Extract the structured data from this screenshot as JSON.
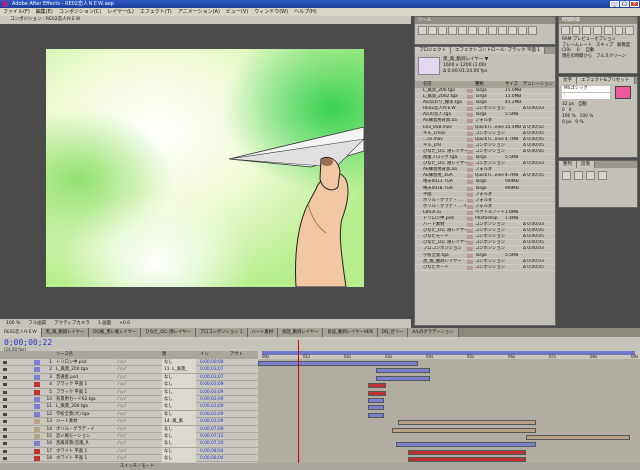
{
  "app": {
    "title": "Adobe After Effects - RE02恋人ＮＥＷ.aep"
  },
  "menu": [
    "ファイル(F)",
    "編集(E)",
    "コンポジション(C)",
    "レイヤー(L)",
    "エフェクト(T)",
    "アニメーション(A)",
    "ビュー(V)",
    "ウィンドウ(W)",
    "ヘルプ(H)"
  ],
  "window_buttons": [
    "_",
    "□",
    "×"
  ],
  "comp_viewer": {
    "tab": "コンポジション : RE02恋人ＮＥＷ",
    "zoom": "100 %",
    "quality": "フル画質",
    "view": "アクティブカメラ",
    "views": "1 画面",
    "exposure": "+0.0"
  },
  "tools_panel": {
    "title": "ツール"
  },
  "project_panel": {
    "tabs": [
      "プロジェクト",
      "エフェクトコントロール: ブラック 平面 1"
    ],
    "selected_name": "黒_風_動詞レイヤー ▼",
    "selected_info": "1600 x 1200 (1.00)",
    "selected_duration": "Δ 0;00;01;24.00 fps",
    "columns": [
      "名前",
      "種類",
      "サイズ",
      "デュレーション"
    ],
    "items": [
      {
        "name": "L_風景_200.tga",
        "type": "Targa",
        "size": "15.0MB",
        "dur": ""
      },
      {
        "name": "L_風景_2002.tga",
        "type": "Targa",
        "size": "15.0MB",
        "dur": ""
      },
      {
        "name": "A/L伝わり_緑茶.tga",
        "type": "Targa",
        "size": "45.2MB",
        "dur": ""
      },
      {
        "name": "RE02恋人ＮＥＷ",
        "type": "コンポジション",
        "size": "",
        "dur": "Δ 0;00;03"
      },
      {
        "name": "A/Lの恋人.tga",
        "type": "Targa",
        "size": "5.5MB",
        "dur": ""
      },
      {
        "name": "AE練習用背景.aa",
        "type": "フォルダ",
        "size": "",
        "dur": ""
      },
      {
        "name": "L03_058.mov",
        "type": "QuickTi...ovie",
        "size": "15.4MB",
        "dur": "Δ 0;00;02"
      },
      {
        "name": "キル_Lmov",
        "type": "コンポジション",
        "size": "",
        "dur": "Δ 0;00;05"
      },
      {
        "name": "...ce.mov",
        "type": "QuickTi...ovie",
        "size": "4.7MB",
        "dur": "Δ 0;00;05"
      },
      {
        "name": "キル_LYR",
        "type": "コンポジション",
        "size": "",
        "dur": "Δ 0;00;05"
      },
      {
        "name": "ひなた_Oに 隠レイヤー",
        "type": "コンポジション",
        "size": "",
        "dur": "Δ 0;00;05"
      },
      {
        "name": "階層ブロック.tga",
        "type": "Targa",
        "size": "5.5MB",
        "dur": ""
      },
      {
        "name": "ひなた_Oに 隠レイヤー",
        "type": "コンポジション",
        "size": "",
        "dur": "Δ 0;00;03"
      },
      {
        "name": "AE練習用背景.aa",
        "type": "フォルダ",
        "size": "",
        "dur": ""
      },
      {
        "name": "AE練習用_1GA",
        "type": "QuickTi...ovie",
        "size": "4.7MB",
        "dur": "Δ 0;00;05"
      },
      {
        "name": "晴天0011.TGA",
        "type": "Targa",
        "size": "949KB",
        "dur": ""
      },
      {
        "name": "晴天0018.TGA",
        "type": "Targa",
        "size": "949KB",
        "dur": ""
      },
      {
        "name": "平面",
        "type": "フォルダ",
        "size": "",
        "dur": ""
      },
      {
        "name": "ポリル・グラデ・ ...",
        "type": "フォルダ",
        "size": "",
        "dur": ""
      },
      {
        "name": "ポリル・グラデ・ ...イヤー",
        "type": "フォルダ",
        "size": "",
        "dur": ""
      },
      {
        "name": "LB03F.ai",
        "type": "ベクトルアート",
        "size": "1.0MB",
        "dur": ""
      },
      {
        "name": "トリロン中.psd",
        "type": "Photoshop",
        "size": "1.4MB",
        "dur": ""
      },
      {
        "name": "ハート素材",
        "type": "コンポジション",
        "size": "",
        "dur": "Δ 0;00;03"
      },
      {
        "name": "ひなた_Oに 隠レイヤー",
        "type": "コンポジション",
        "size": "",
        "dur": "Δ 0;00;05"
      },
      {
        "name": "ひなたモード",
        "type": "コンポジション",
        "size": "",
        "dur": "Δ 0;00;05"
      },
      {
        "name": "ひなた_Oに 隠レイヤー",
        "type": "コンポジション",
        "size": "",
        "dur": "Δ 0;00;05"
      },
      {
        "name": "ブロコンポジション",
        "type": "コンポジション",
        "size": "",
        "dur": "Δ 0;00;03"
      },
      {
        "name": "学校全景.tga",
        "type": "Targa",
        "size": "5.5MB",
        "dur": ""
      },
      {
        "name": "黒_風_動詞レイヤー",
        "type": "コンポジション",
        "size": "",
        "dur": "Δ 0;00;03"
      },
      {
        "name": "ひなたネード",
        "type": "コンポジション",
        "size": "",
        "dur": "Δ 0;00;05"
      }
    ]
  },
  "preview_panel": {
    "title": "時間制御",
    "ram_label": "RAM プレビューオプション",
    "framerate_label": "フレームレート",
    "skip_label": "スキップ",
    "resolution_label": "解像度",
    "framerate": "(29)",
    "skip": "0",
    "resolution": "自動",
    "from_label": "現在の時間から",
    "fullscreen_label": "フルスクリーン"
  },
  "text_panel": {
    "tabs": [
      "文字",
      "エフェクト&プリセット"
    ],
    "font": "MSゴシック",
    "font_style": "-",
    "size": "32 px",
    "tracking": "自動",
    "leading": "0",
    "scale_v": "100 %",
    "scale_h": "100 %",
    "baseline": "0 px",
    "tsume": "0 %",
    "swatch_color": "#ef5a9c"
  },
  "align_panel": {
    "tabs": [
      "整列",
      "段落"
    ]
  },
  "timeline": {
    "tabs": [
      "RE02恋人ＮＥＷ",
      "黒_風_動詞レイヤー",
      "DQ風_黒い風レイヤー",
      "ひなた_Oに 隠レイヤー",
      "ブロコンポジション 1",
      "ハート素材",
      "会話_動詞レイヤー",
      "長居_動詞レイヤーVEN",
      "DQ_ゼリー",
      "A/Lのグラデーション"
    ],
    "timecode": "0;00;00;22",
    "fps": "(24.00 fps)",
    "col_source": "ソース名",
    "col_parent": "親",
    "col_in": "イン",
    "col_out": "アウト",
    "ruler_labels": [
      "00s",
      "01s",
      "02s",
      "03s",
      "04s",
      "05s",
      "06s",
      "07s",
      "08s",
      "09s"
    ],
    "footer": "スイッチ / モード",
    "layers": [
      {
        "num": "1",
        "name": "トリロン中.psd",
        "parent": "なし",
        "in": "0;00;00;00",
        "color": "#7a7fd1"
      },
      {
        "num": "2",
        "name": "L_風景_200.tga",
        "parent": "11. L_風景_",
        "in": "0;00;03;07",
        "color": "#7a7fd1"
      },
      {
        "num": "3",
        "name": "普通屋.psd",
        "parent": "なし",
        "in": "0;00;03;07",
        "color": "#7a7fd1"
      },
      {
        "num": "4",
        "name": "ブラック 平面 1",
        "parent": "なし",
        "in": "0;00;03;09",
        "color": "#c03232"
      },
      {
        "num": "5",
        "name": "ブラック 平面 1",
        "parent": "なし",
        "in": "0;00;03;09",
        "color": "#c03232"
      },
      {
        "num": "10",
        "name": "背景用カード02.tga",
        "parent": "なし",
        "in": "0;00;03;09",
        "color": "#7a7fd1"
      },
      {
        "num": "11",
        "name": "L_風景_200.tga",
        "parent": "なし",
        "in": "0;00;03;09",
        "color": "#7a7fd1"
      },
      {
        "num": "12",
        "name": "学校全景(大).tga",
        "parent": "なし",
        "in": "0;00;03;09",
        "color": "#7a7fd1"
      },
      {
        "num": "13",
        "name": "ハート素材",
        "parent": "14. 風_風",
        "in": "0;00;03;09",
        "color": "#b6a285"
      },
      {
        "num": "14",
        "name": "ボリル・グラデ・イ",
        "parent": "なし",
        "in": "0;00;07;09",
        "color": "#b6a285"
      },
      {
        "num": "15",
        "name": "恋い風モーション",
        "parent": "なし",
        "in": "0;00;07;12",
        "color": "#b6a285"
      },
      {
        "num": "16",
        "name": "黒風背景(恋風_R",
        "parent": "なし",
        "in": "0;00;07;20",
        "color": "#7a7fd1"
      },
      {
        "num": "17",
        "name": "ホワイト 平面 1",
        "parent": "なし",
        "in": "0;00;08;04",
        "color": "#c03232"
      },
      {
        "num": "18",
        "name": "ホワイト 平面 1",
        "parent": "なし",
        "in": "0;00;08;04",
        "color": "#c03232"
      }
    ]
  }
}
